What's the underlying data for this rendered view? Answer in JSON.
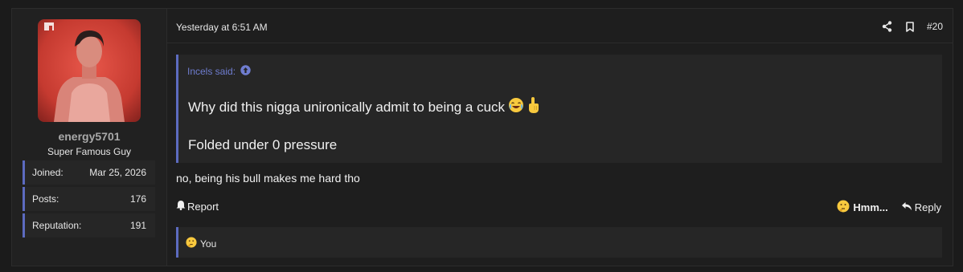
{
  "user": {
    "name": "energy5701",
    "title": "Super Famous Guy",
    "stats": [
      {
        "label": "Joined:",
        "value": "Mar 25, 2026"
      },
      {
        "label": "Posts:",
        "value": "176"
      },
      {
        "label": "Reputation:",
        "value": "191"
      }
    ]
  },
  "post": {
    "time": "Yesterday at 6:51 AM",
    "number": "#20",
    "quote": {
      "author": "Incels said:",
      "line1": "Why did this nigga unironically admit to being a cuck",
      "line2": "Folded under 0 pressure"
    },
    "body": "no, being his bull makes me hard tho",
    "actions": {
      "report": "Report",
      "reaction": "Hmm...",
      "reply": "Reply"
    },
    "reactions_summary": "You"
  },
  "colors": {
    "accent": "#5c6bc0",
    "link": "#6f7dd0",
    "background": "#1b1b1b",
    "panel": "#262626"
  }
}
